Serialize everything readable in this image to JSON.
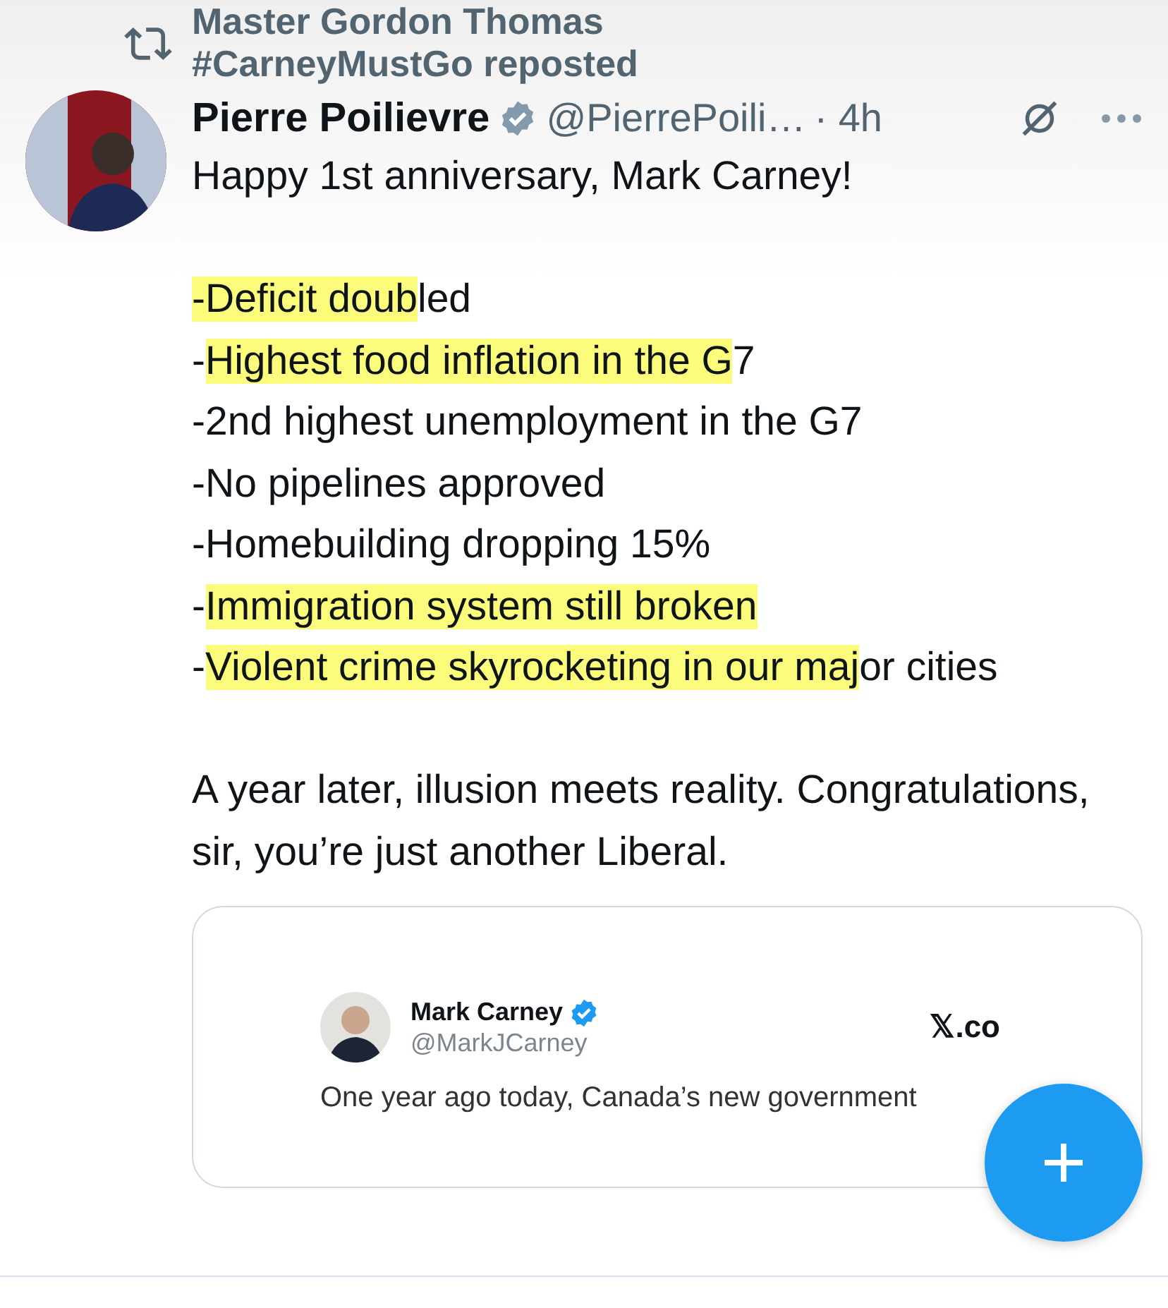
{
  "repost": {
    "text": "Master Gordon Thomas\n#CarneyMustGo reposted"
  },
  "post": {
    "author": "Pierre Poilievre",
    "handle": "@PierrePoili…",
    "time": "· 4h",
    "intro": "Happy 1st anniversary, Mark Carney!",
    "list": [
      [
        {
          "text": "-Deficit doub",
          "highlight": true
        },
        {
          "text": "led",
          "highlight": false
        }
      ],
      [
        {
          "text": "-",
          "highlight": false
        },
        {
          "text": "Highest food inflation in the G",
          "highlight": true
        },
        {
          "text": "7",
          "highlight": false
        }
      ],
      [
        {
          "text": "-2nd highest unemployment in the G7",
          "highlight": false
        }
      ],
      [
        {
          "text": "-No pipelines approved",
          "highlight": false
        }
      ],
      [
        {
          "text": "-Homebuilding dropping 15%",
          "highlight": false
        }
      ],
      [
        {
          "text": "-",
          "highlight": false
        },
        {
          "text": "Immigration system still broken",
          "highlight": true
        }
      ],
      [
        {
          "text": "-",
          "highlight": false
        },
        {
          "text": "Violent crime skyrocketing in our maj",
          "highlight": true
        },
        {
          "text": "or cities",
          "highlight": false
        }
      ]
    ],
    "closing": "A year later, illusion meets reality. Congratulations, sir, you’re just another Liberal."
  },
  "quote": {
    "author": "Mark Carney",
    "handle": "@MarkJCarney",
    "site": "𝕏.co",
    "text": "One year ago today, Canada’s new government"
  }
}
